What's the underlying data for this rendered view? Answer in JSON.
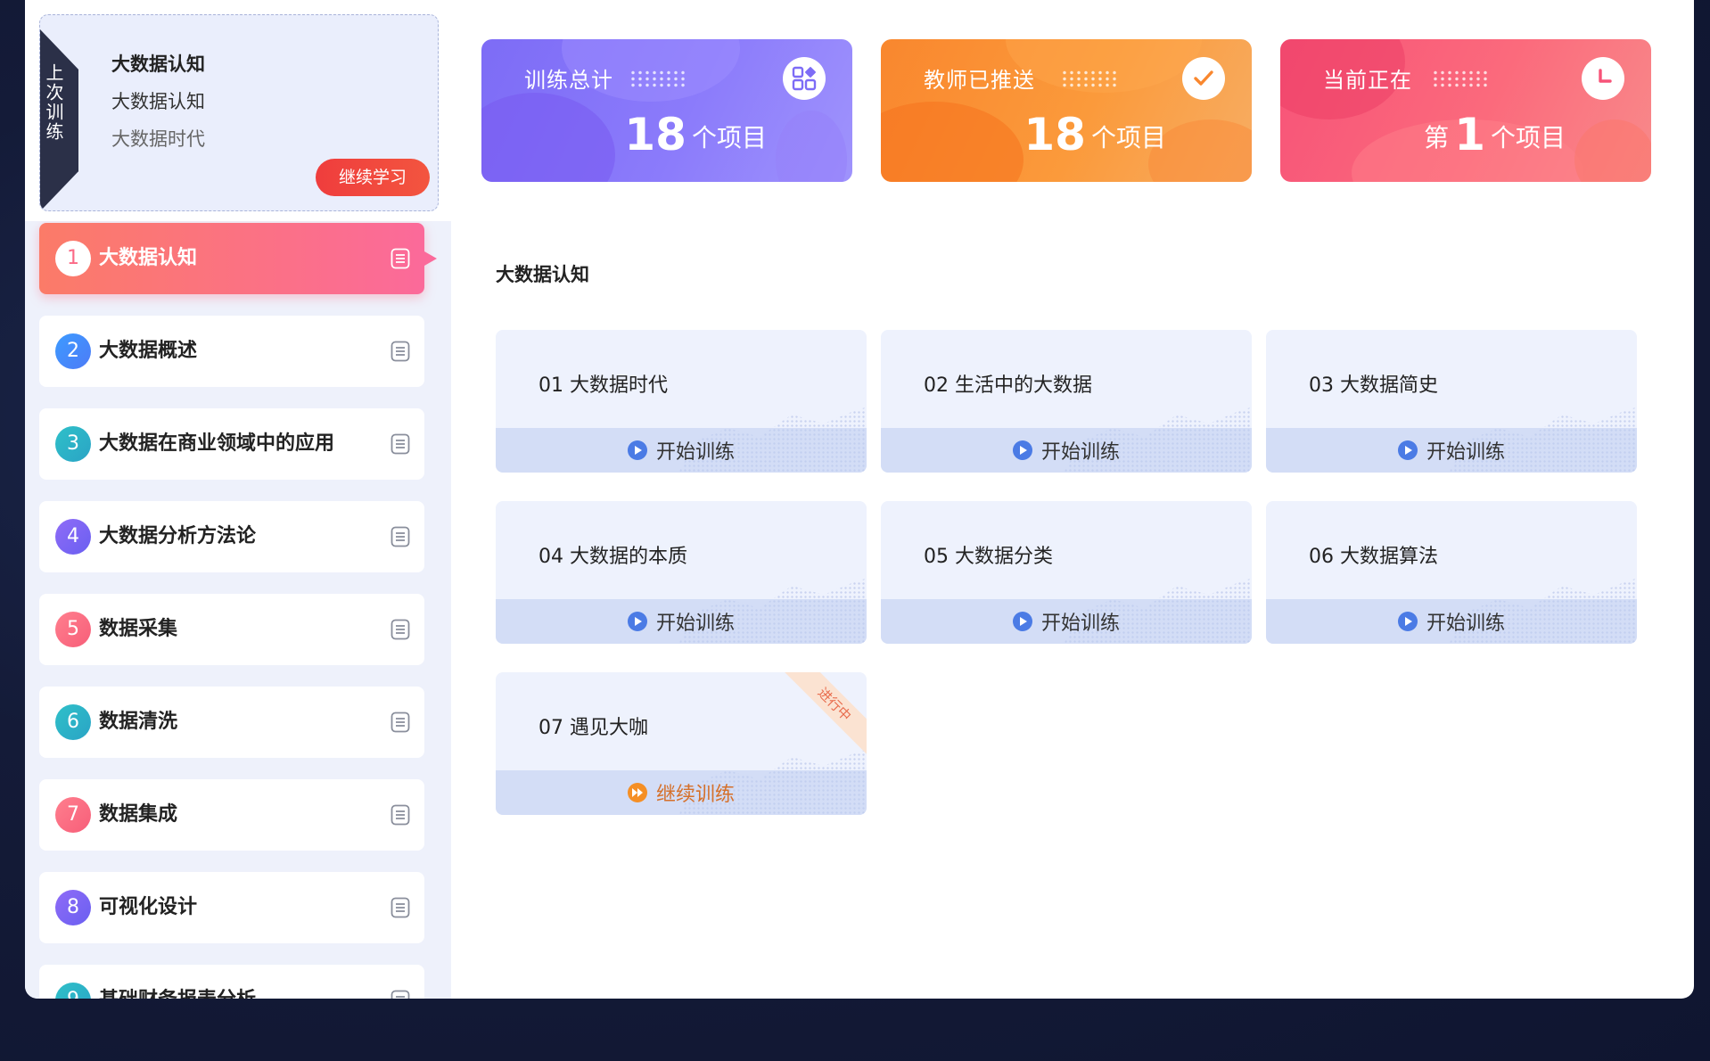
{
  "last_training": {
    "tag": "上次训练",
    "lines": [
      "大数据认知",
      "大数据认知",
      "大数据时代"
    ],
    "continue_label": "继续学习"
  },
  "stats": [
    {
      "label": "训练总计",
      "prefix": "",
      "value": "18",
      "suffix": "个项目",
      "icon": "grid-apps-icon",
      "color": "#7d6cf6"
    },
    {
      "label": "教师已推送",
      "prefix": "",
      "value": "18",
      "suffix": "个项目",
      "icon": "check-icon",
      "color": "#f9872e"
    },
    {
      "label": "当前正在",
      "prefix": "第",
      "value": "1",
      "suffix": "个项目",
      "icon": "clock-icon",
      "color": "#f75378"
    }
  ],
  "sidebar": {
    "items": [
      {
        "num": "1",
        "label": "大数据认知",
        "active": true
      },
      {
        "num": "2",
        "label": "大数据概述"
      },
      {
        "num": "3",
        "label": "大数据在商业领域中的应用"
      },
      {
        "num": "4",
        "label": "大数据分析方法论"
      },
      {
        "num": "5",
        "label": "数据采集"
      },
      {
        "num": "6",
        "label": "数据清洗"
      },
      {
        "num": "7",
        "label": "数据集成"
      },
      {
        "num": "8",
        "label": "可视化设计"
      },
      {
        "num": "9",
        "label": "基础财务报表分析"
      }
    ]
  },
  "main": {
    "title": "大数据认知",
    "cards": [
      {
        "title": "01 大数据时代",
        "action": "开始训练"
      },
      {
        "title": "02 生活中的大数据",
        "action": "开始训练"
      },
      {
        "title": "03 大数据简史",
        "action": "开始训练"
      },
      {
        "title": "04 大数据的本质",
        "action": "开始训练"
      },
      {
        "title": "05 大数据分类",
        "action": "开始训练"
      },
      {
        "title": "06 大数据算法",
        "action": "开始训练"
      },
      {
        "title": "07 遇见大咖",
        "action": "继续训练",
        "badge": "进行中"
      }
    ]
  }
}
